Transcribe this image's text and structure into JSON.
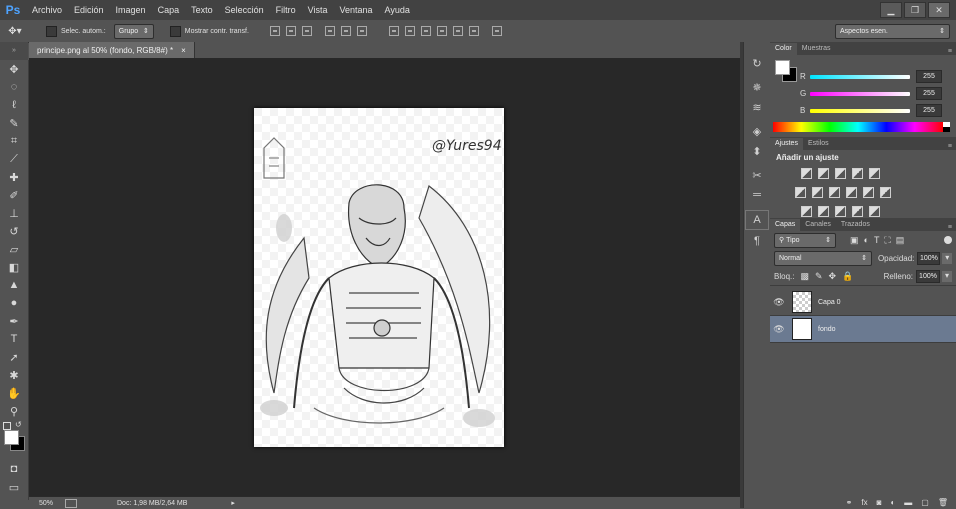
{
  "app": {
    "logo": "Ps"
  },
  "menu": [
    "Archivo",
    "Edición",
    "Imagen",
    "Capa",
    "Texto",
    "Selección",
    "Filtro",
    "Vista",
    "Ventana",
    "Ayuda"
  ],
  "window_controls": {
    "minimize": "▁",
    "restore": "❐",
    "close": "✕"
  },
  "options_bar": {
    "auto_select_label": "Selec. autom.:",
    "auto_select_target": "Grupo",
    "show_transform_label": "Mostrar contr. transf.",
    "workspace_label": "Aspectos esen."
  },
  "document": {
    "tab_title": "principe.png al 50% (fondo, RGB/8#) *",
    "tab_close": "×",
    "watermark": "@Yures94"
  },
  "status": {
    "zoom": "50%",
    "doc_info": "Doc: 1,98 MB/2,64 MB"
  },
  "color_panel": {
    "tabs": [
      "Color",
      "Muestras"
    ],
    "channels": [
      {
        "label": "R",
        "value": "255",
        "gradient_color": "#00e5ff"
      },
      {
        "label": "G",
        "value": "255",
        "gradient_color": "#ff00ff"
      },
      {
        "label": "B",
        "value": "255",
        "gradient_color": "#ffff00"
      }
    ],
    "foreground": "#ffffff",
    "background": "#000000"
  },
  "adjust_panel": {
    "tabs": [
      "Ajustes",
      "Estilos"
    ],
    "heading": "Añadir un ajuste"
  },
  "layers_panel": {
    "tabs": [
      "Capas",
      "Canales",
      "Trazados"
    ],
    "filter_kind": "Tipo",
    "blend_mode": "Normal",
    "opacity_label": "Opacidad:",
    "opacity_value": "100%",
    "lock_label": "Bloq.:",
    "fill_label": "Relleno:",
    "fill_value": "100%",
    "layers": [
      {
        "name": "Capa 0",
        "selected": false
      },
      {
        "name": "fondo",
        "selected": true
      }
    ],
    "footer_icons": [
      "link-icon",
      "fx-icon",
      "mask-icon",
      "adjustment-icon",
      "folder-icon",
      "new-layer-icon",
      "trash-icon"
    ]
  },
  "tools": [
    "move-tool",
    "marquee-tool",
    "lasso-tool",
    "quick-select-tool",
    "crop-tool",
    "eyedropper-tool",
    "healing-tool",
    "brush-tool",
    "stamp-tool",
    "history-brush-tool",
    "eraser-tool",
    "gradient-tool",
    "blur-tool",
    "dodge-tool",
    "pen-tool",
    "type-tool",
    "path-select-tool",
    "shape-tool",
    "hand-tool",
    "zoom-tool"
  ],
  "colors": {
    "selected_layer": "#6b7a91",
    "workspace": "#282828",
    "panel": "#535353"
  }
}
